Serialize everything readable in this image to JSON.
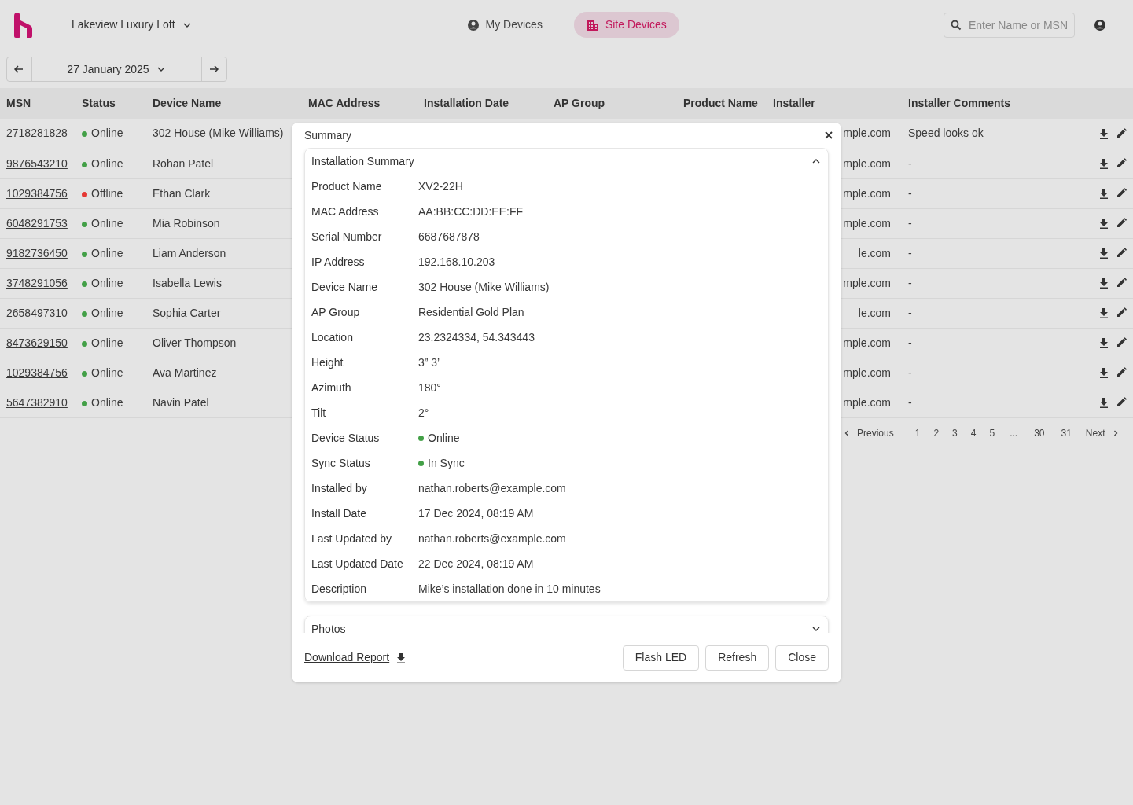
{
  "header": {
    "site_name": "Lakeview Luxury Loft",
    "tabs": [
      {
        "label": "My Devices",
        "kind": "person",
        "selected": false
      },
      {
        "label": "Site Devices",
        "kind": "building",
        "selected": true
      }
    ],
    "search": {
      "placeholder": "Enter Name or MSN"
    }
  },
  "date_nav": {
    "date": "27 January 2025"
  },
  "table": {
    "columns": [
      "MSN",
      "Status",
      "Device Name",
      "MAC Address",
      "Installation Date",
      "AP Group",
      "Product Name",
      "Installer",
      "Installer Comments"
    ],
    "rows": [
      {
        "msn": "2718281828",
        "status": "Online",
        "color": "#43a047",
        "device_name": "302 House (Mike Williams)",
        "installer": "mple.com",
        "comments": "Speed looks ok"
      },
      {
        "msn": "9876543210",
        "status": "Online",
        "color": "#43a047",
        "device_name": "Rohan Patel",
        "installer": "mple.com",
        "comments": "-"
      },
      {
        "msn": "1029384756",
        "status": "Offline",
        "color": "#e53935",
        "device_name": "Ethan Clark",
        "installer": "mple.com",
        "comments": "-"
      },
      {
        "msn": "6048291753",
        "status": "Online",
        "color": "#43a047",
        "device_name": "Mia Robinson",
        "installer": "mple.com",
        "comments": "-"
      },
      {
        "msn": "9182736450",
        "status": "Online",
        "color": "#43a047",
        "device_name": "Liam Anderson",
        "installer": "le.com",
        "comments": "-"
      },
      {
        "msn": "3748291056",
        "status": "Online",
        "color": "#43a047",
        "device_name": "Isabella Lewis",
        "installer": "mple.com",
        "comments": "-"
      },
      {
        "msn": "2658497310",
        "status": "Online",
        "color": "#43a047",
        "device_name": "Sophia Carter",
        "installer": "le.com",
        "comments": "-"
      },
      {
        "msn": "8473629150",
        "status": "Online",
        "color": "#43a047",
        "device_name": "Oliver Thompson",
        "installer": "mple.com",
        "comments": "-"
      },
      {
        "msn": "1029384756",
        "status": "Online",
        "color": "#43a047",
        "device_name": "Ava Martinez",
        "installer": "mple.com",
        "comments": "-"
      },
      {
        "msn": "5647382910",
        "status": "Online",
        "color": "#43a047",
        "device_name": "Navin Patel",
        "installer": "mple.com",
        "comments": "-"
      }
    ]
  },
  "pagination": {
    "previous": "Previous",
    "pages": [
      "1",
      "2",
      "3",
      "4",
      "5",
      "...",
      "30",
      "31"
    ],
    "next": "Next"
  },
  "modal": {
    "title": "Summary",
    "sections": [
      {
        "title": "Installation Summary",
        "expanded": true,
        "fields": [
          {
            "label": "Product Name",
            "value": "XV2-22H"
          },
          {
            "label": "MAC Address",
            "value": "AA:BB:CC:DD:EE:FF"
          },
          {
            "label": "Serial Number",
            "value": "6687687878"
          },
          {
            "label": "IP Address",
            "value": "192.168.10.203"
          },
          {
            "label": "Device Name",
            "value": "302 House (Mike Williams)"
          },
          {
            "label": "AP Group",
            "value": "Residential Gold Plan"
          },
          {
            "label": "Location",
            "value": "23.2324334, 54.343443"
          },
          {
            "label": "Height",
            "value": "3” 3’"
          },
          {
            "label": "Azimuth",
            "value": "180°"
          },
          {
            "label": "Tilt",
            "value": "2°"
          },
          {
            "label": "Device Status",
            "value": "Online",
            "color": "#43a047"
          },
          {
            "label": "Sync Status",
            "value": "In Sync",
            "color": "#43a047"
          },
          {
            "label": "Installed by",
            "value": "nathan.roberts@example.com"
          },
          {
            "label": "Install Date",
            "value": "17 Dec 2024, 08:19 AM"
          },
          {
            "label": "Last Updated by",
            "value": "nathan.roberts@example.com"
          },
          {
            "label": "Last Updated Date",
            "value": "22 Dec 2024, 08:19 AM"
          },
          {
            "label": "Description",
            "value": "Mike’s installation done in 10 minutes"
          }
        ]
      },
      {
        "title": "Photos",
        "expanded": false
      }
    ],
    "download_link": "Download Report",
    "buttons": [
      "Flash LED",
      "Refresh",
      "Close"
    ]
  }
}
